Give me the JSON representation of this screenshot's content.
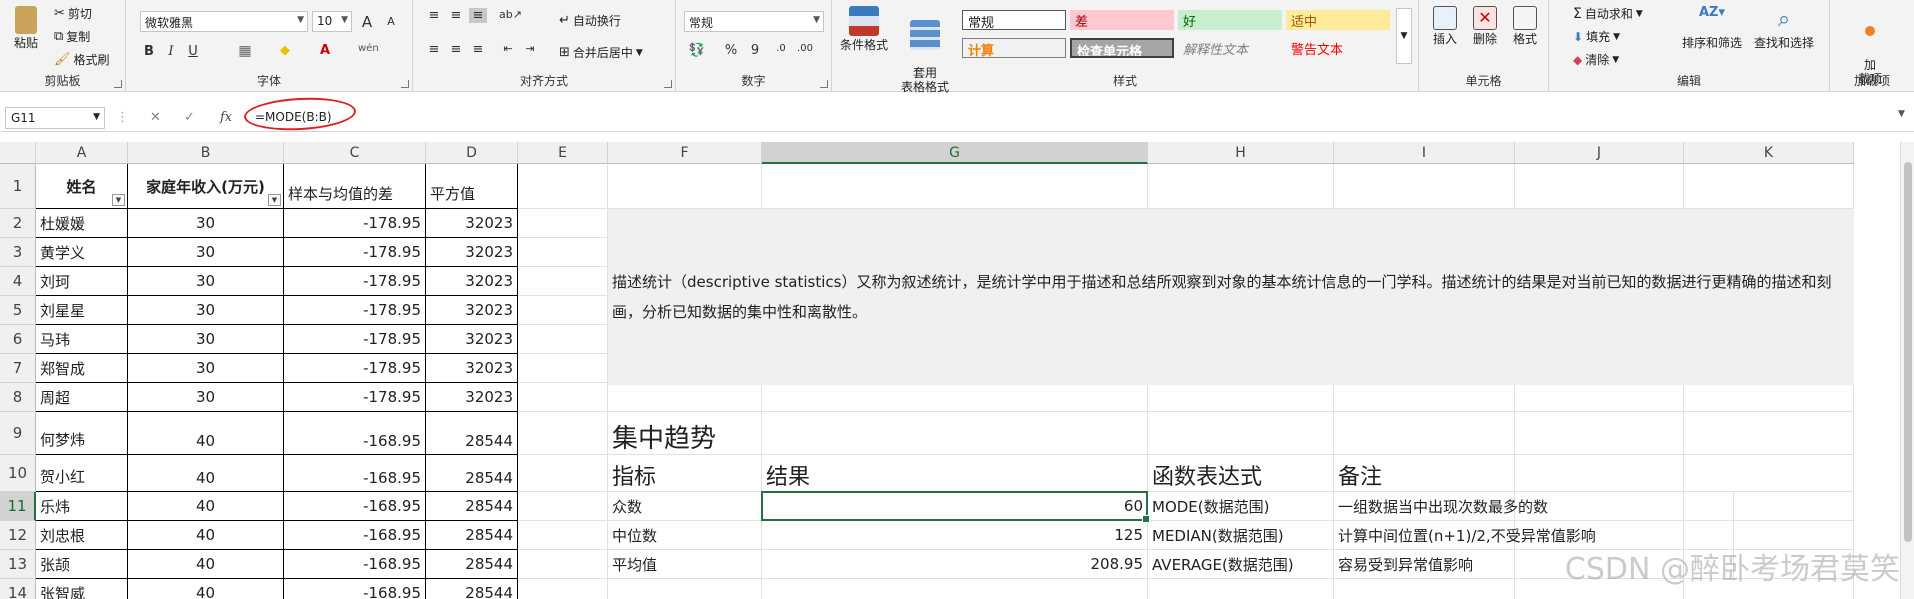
{
  "ribbon": {
    "clipboard": {
      "paste": "粘贴",
      "cut": "剪切",
      "copy": "复制",
      "format_painter": "格式刷",
      "label": "剪贴板"
    },
    "font": {
      "name": "微软雅黑",
      "size": "10",
      "grow": "A",
      "shrink": "A",
      "bold": "B",
      "italic": "I",
      "underline": "U",
      "label": "字体"
    },
    "alignment": {
      "wrap": "自动换行",
      "merge": "合并后居中",
      "label": "对齐方式"
    },
    "number": {
      "format": "常规",
      "percent": "%",
      "comma": "9",
      "label": "数字"
    },
    "styles": {
      "conditional": "条件格式",
      "table_format": "套用\n表格格式",
      "cells": [
        "常规",
        "差",
        "好",
        "适中",
        "计算",
        "检查单元格",
        "解释性文本",
        "警告文本"
      ],
      "label": "样式"
    },
    "cells": {
      "insert": "插入",
      "delete": "删除",
      "format": "格式",
      "label": "单元格"
    },
    "editing": {
      "autosum": "自动求和",
      "fill": "填充",
      "clear": "清除",
      "sort_filter": "排序和筛选",
      "find_select": "查找和选择",
      "label": "编辑"
    },
    "addins": {
      "addins": "加\n载项",
      "label": "加载项"
    }
  },
  "formula_bar": {
    "name_box": "G11",
    "formula": "=MODE(B:B)"
  },
  "columns": [
    "A",
    "B",
    "C",
    "D",
    "E",
    "F",
    "G",
    "H",
    "I",
    "J",
    "K"
  ],
  "rows": [
    "1",
    "2",
    "3",
    "4",
    "5",
    "6",
    "7",
    "8",
    "9",
    "10",
    "11",
    "12",
    "13",
    "14"
  ],
  "table": {
    "headers": [
      "姓名",
      "家庭年收入(万元)",
      "样本与均值的差",
      "平方值"
    ],
    "records": [
      [
        "杜媛媛",
        "30",
        "-178.95",
        "32023"
      ],
      [
        "黄学义",
        "30",
        "-178.95",
        "32023"
      ],
      [
        "刘珂",
        "30",
        "-178.95",
        "32023"
      ],
      [
        "刘星星",
        "30",
        "-178.95",
        "32023"
      ],
      [
        "马玮",
        "30",
        "-178.95",
        "32023"
      ],
      [
        "郑智成",
        "30",
        "-178.95",
        "32023"
      ],
      [
        "周超",
        "30",
        "-178.95",
        "32023"
      ],
      [
        "何梦炜",
        "40",
        "-168.95",
        "28544"
      ],
      [
        "贺小红",
        "40",
        "-168.95",
        "28544"
      ],
      [
        "乐炜",
        "40",
        "-168.95",
        "28544"
      ],
      [
        "刘忠根",
        "40",
        "-168.95",
        "28544"
      ],
      [
        "张颉",
        "40",
        "-168.95",
        "28544"
      ],
      [
        "张智威",
        "40",
        "-168.95",
        "28544"
      ]
    ]
  },
  "description": "描述统计（descriptive statistics）又称为叙述统计，是统计学中用于描述和总结所观察到对象的基本统计信息的一门学科。描述统计的结果是对当前已知的数据进行更精确的描述和刻画，分析已知数据的集中性和离散性。",
  "stats": {
    "title": "集中趋势",
    "headers": [
      "指标",
      "结果",
      "函数表达式",
      "备注"
    ],
    "rows": [
      [
        "众数",
        "60",
        "MODE(数据范围)",
        "一组数据当中出现次数最多的数"
      ],
      [
        "中位数",
        "125",
        "MEDIAN(数据范围)",
        "计算中间位置(n+1)/2,不受异常值影响"
      ],
      [
        "平均值",
        "208.95",
        "AVERAGE(数据范围)",
        "容易受到异常值影响"
      ]
    ]
  },
  "watermark": "CSDN @醉卧考场君莫笑",
  "colors": {
    "accent": "#217346",
    "annotation": "#e02020"
  }
}
